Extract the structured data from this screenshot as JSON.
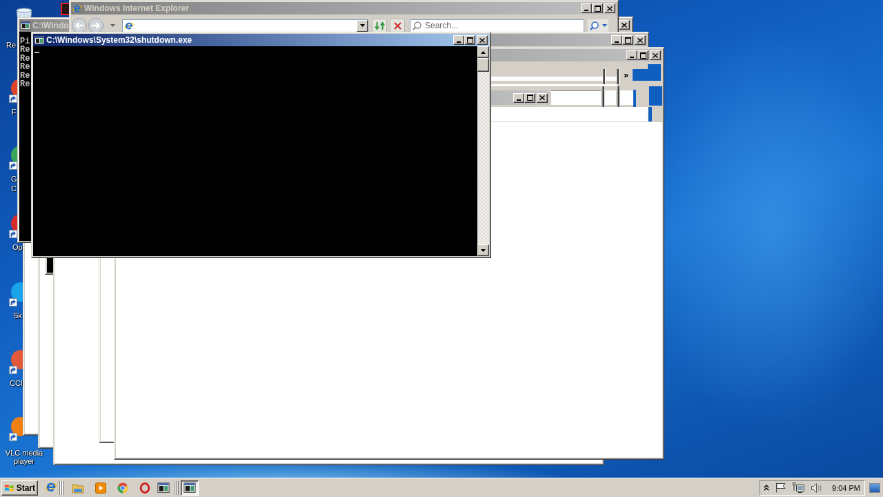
{
  "desktop_icons": [
    {
      "kind": "recycle-bin",
      "lines": [
        "Re"
      ]
    },
    {
      "kind": "shortcut",
      "color": "#e0452c",
      "lines": [
        "F"
      ]
    },
    {
      "kind": "shortcut",
      "color": "#3aa757",
      "lines": [
        "G",
        "C"
      ]
    },
    {
      "kind": "shortcut",
      "color": "#d52b2b",
      "lines": [
        "Op"
      ]
    },
    {
      "kind": "shortcut",
      "color": "#1aa3e8",
      "lines": [
        "Sk"
      ]
    },
    {
      "kind": "shortcut",
      "color": "#e25a3a",
      "lines": [
        "CCl"
      ]
    },
    {
      "kind": "shortcut",
      "color": "#f07f14",
      "lines": [
        "VLC media",
        "player"
      ]
    },
    {
      "kind": "document",
      "color": "#e02020"
    }
  ],
  "windows": [
    {
      "kind": "blank"
    },
    {
      "kind": "blank"
    },
    {
      "kind": "console"
    },
    {
      "kind": "titled",
      "active": false,
      "controls": [
        {
          "kind": "close"
        }
      ]
    },
    {
      "kind": "console",
      "title": "C:\\Windo",
      "active": false,
      "lines": [
        "Pi",
        "Re",
        "Re",
        "Re",
        "Re",
        "Re"
      ]
    },
    {
      "kind": "browser",
      "title": "Windows Internet Explorer",
      "active": false,
      "controls": [
        {
          "kind": "minimize"
        },
        {
          "kind": "maximize"
        },
        {
          "kind": "close"
        }
      ],
      "search": {
        "placeholder": "Search..."
      }
    },
    {
      "kind": "blank"
    },
    {
      "kind": "blank"
    },
    {
      "kind": "titled",
      "active": false,
      "controls": [
        {
          "kind": "minimize"
        },
        {
          "kind": "maximize"
        },
        {
          "kind": "close"
        }
      ]
    },
    {
      "kind": "explorer",
      "active": false,
      "controls": [
        {
          "kind": "minimize"
        },
        {
          "kind": "maximize"
        },
        {
          "kind": "close"
        }
      ],
      "toolbar": {
        "chevron": "»"
      },
      "child_window": {
        "active": false,
        "controls": [
          {
            "kind": "minimize"
          },
          {
            "kind": "maximize"
          },
          {
            "kind": "close"
          }
        ]
      }
    },
    {
      "kind": "console",
      "title": "C:\\Windows\\System32\\shutdown.exe",
      "active": true,
      "controls": [
        {
          "kind": "minimize"
        },
        {
          "kind": "maximize"
        },
        {
          "kind": "close"
        }
      ],
      "cursor": true,
      "scrollbar": true
    }
  ],
  "taskbar": {
    "start": "Start",
    "quick_launch": [
      {
        "kind": "browser"
      },
      {
        "kind": "folder"
      },
      {
        "kind": "player"
      },
      {
        "kind": "orb"
      },
      {
        "kind": "ring"
      }
    ],
    "tasks": [
      {
        "kind": "console",
        "selected": false
      },
      {
        "kind": "console",
        "selected": true
      }
    ],
    "clock": "9:04 PM"
  }
}
